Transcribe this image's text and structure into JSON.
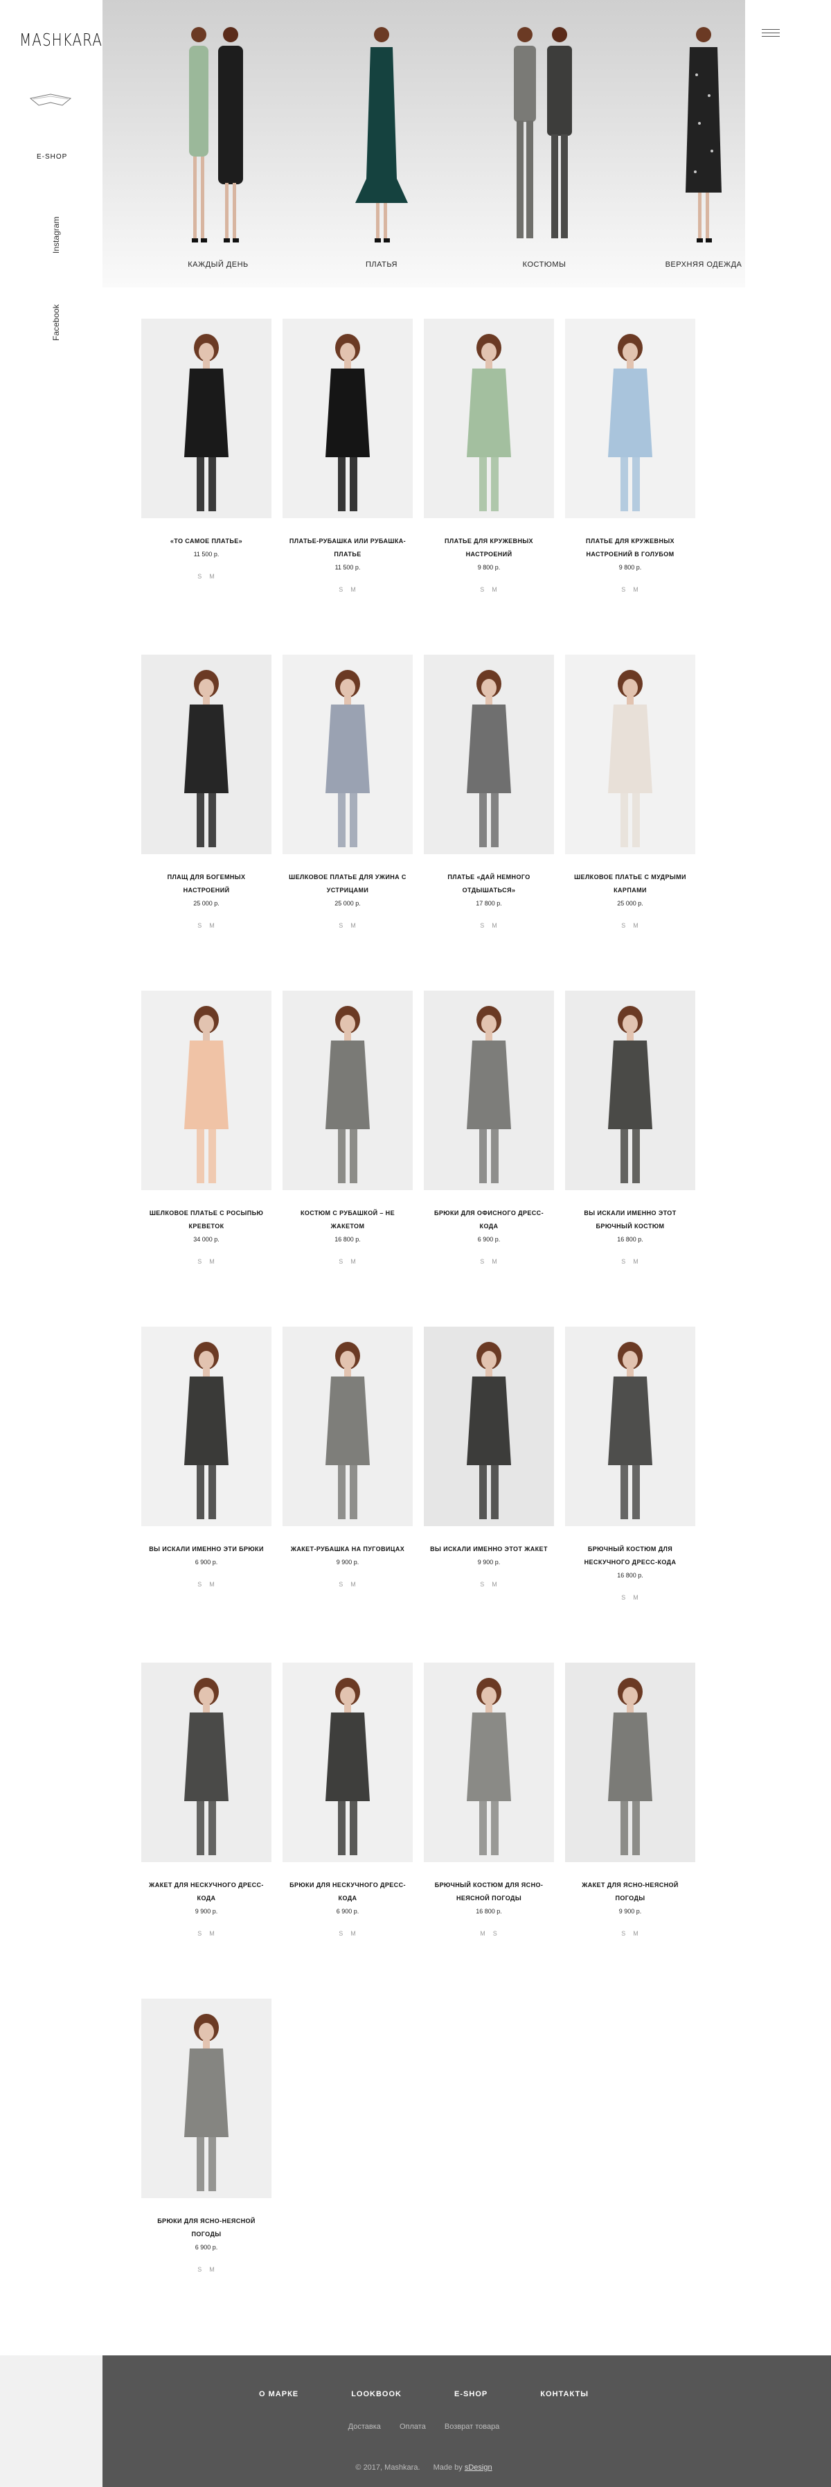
{
  "brand": {
    "logo": "MASHKARA"
  },
  "sidebar": {
    "eshop": "E-SHOP",
    "instagram": "Instagram",
    "facebook": "Facebook"
  },
  "categories": [
    {
      "label": "КАЖДЫЙ ДЕНЬ"
    },
    {
      "label": "ПЛАТЬЯ"
    },
    {
      "label": "КОСТЮМЫ"
    },
    {
      "label": "ВЕРХНЯЯ ОДЕЖДА"
    }
  ],
  "products": [
    {
      "name": "«ТО САМОЕ ПЛАТЬЕ»",
      "price": "11 500 р.",
      "sizes": [
        "S",
        "M"
      ]
    },
    {
      "name": "ПЛАТЬЕ-РУБАШКА ИЛИ РУБАШКА-ПЛАТЬЕ",
      "price": "11 500 р.",
      "sizes": [
        "S",
        "M"
      ]
    },
    {
      "name": "ПЛАТЬЕ ДЛЯ КРУЖЕВНЫХ НАСТРОЕНИЙ",
      "price": "9 800 р.",
      "sizes": [
        "S",
        "M"
      ]
    },
    {
      "name": "ПЛАТЬЕ ДЛЯ КРУЖЕВНЫХ НАСТРОЕНИЙ В ГОЛУБОМ",
      "price": "9 800 р.",
      "sizes": [
        "S",
        "M"
      ]
    },
    {
      "name": "ПЛАЩ ДЛЯ БОГЕМНЫХ НАСТРОЕНИЙ",
      "price": "25 000 р.",
      "sizes": [
        "S",
        "M"
      ]
    },
    {
      "name": "ШЕЛКОВОЕ ПЛАТЬЕ ДЛЯ УЖИНА С УСТРИЦАМИ",
      "price": "25 000 р.",
      "sizes": [
        "S",
        "M"
      ]
    },
    {
      "name": "ПЛАТЬЕ «ДАЙ НЕМНОГО ОТДЫШАТЬСЯ»",
      "price": "17 800 р.",
      "sizes": [
        "S",
        "M"
      ]
    },
    {
      "name": "ШЕЛКОВОЕ ПЛАТЬЕ С МУДРЫМИ КАРПАМИ",
      "price": "25 000 р.",
      "sizes": [
        "S",
        "M"
      ]
    },
    {
      "name": "ШЕЛКОВОЕ ПЛАТЬЕ С РОСЫПЬЮ КРЕВЕТОК",
      "price": "34 000 р.",
      "sizes": [
        "S",
        "M"
      ]
    },
    {
      "name": "КОСТЮМ С РУБАШКОЙ – НЕ ЖАКЕТОМ",
      "price": "16 800 р.",
      "sizes": [
        "S",
        "M"
      ]
    },
    {
      "name": "БРЮКИ ДЛЯ ОФИСНОГО ДРЕСС-КОДА",
      "price": "6 900 р.",
      "sizes": [
        "S",
        "M"
      ]
    },
    {
      "name": "ВЫ ИСКАЛИ ИМЕННО ЭТОТ БРЮЧНЫЙ КОСТЮМ",
      "price": "16 800 р.",
      "sizes": [
        "S",
        "M"
      ]
    },
    {
      "name": "ВЫ ИСКАЛИ ИМЕННО ЭТИ БРЮКИ",
      "price": "6 900 р.",
      "sizes": [
        "S",
        "M"
      ]
    },
    {
      "name": "ЖАКЕТ-РУБАШКА НА ПУГОВИЦАХ",
      "price": "9 900 р.",
      "sizes": [
        "S",
        "M"
      ]
    },
    {
      "name": "ВЫ ИСКАЛИ ИМЕННО ЭТОТ ЖАКЕТ",
      "price": "9 900 р.",
      "sizes": [
        "S",
        "M"
      ]
    },
    {
      "name": "БРЮЧНЫЙ КОСТЮМ ДЛЯ НЕСКУЧНОГО ДРЕСС-КОДА",
      "price": "16 800 р.",
      "sizes": [
        "S",
        "M"
      ]
    },
    {
      "name": "ЖАКЕТ ДЛЯ НЕСКУЧНОГО ДРЕСС-КОДА",
      "price": "9 900 р.",
      "sizes": [
        "S",
        "M"
      ]
    },
    {
      "name": "БРЮКИ ДЛЯ НЕСКУЧНОГО ДРЕСС-КОДА",
      "price": "6 900 р.",
      "sizes": [
        "S",
        "M"
      ]
    },
    {
      "name": "БРЮЧНЫЙ КОСТЮМ ДЛЯ ЯСНО-НЕЯСНОЙ ПОГОДЫ",
      "price": "16 800 р.",
      "sizes": [
        "M",
        "S"
      ]
    },
    {
      "name": "ЖАКЕТ ДЛЯ ЯСНО-НЕЯСНОЙ ПОГОДЫ",
      "price": "9 900 р.",
      "sizes": [
        "S",
        "M"
      ]
    },
    {
      "name": "БРЮКИ ДЛЯ ЯСНО-НЕЯСНОЙ ПОГОДЫ",
      "price": "6 900 р.",
      "sizes": [
        "S",
        "M"
      ]
    }
  ],
  "footer": {
    "nav": [
      "О МАРКЕ",
      "LOOKBOOK",
      "E-SHOP",
      "КОНТАКТЫ"
    ],
    "sub": [
      "Доставка",
      "Оплата",
      "Возврат товара"
    ],
    "copyright": "© 2017, Mashkara.",
    "made_by": "Made by",
    "studio": "sDesign"
  },
  "colors": {
    "sidebar": "#ffffff",
    "page_bg": "#f1f1f1",
    "footer_bg": "#565656",
    "banner_top": "#cfcfcf"
  }
}
